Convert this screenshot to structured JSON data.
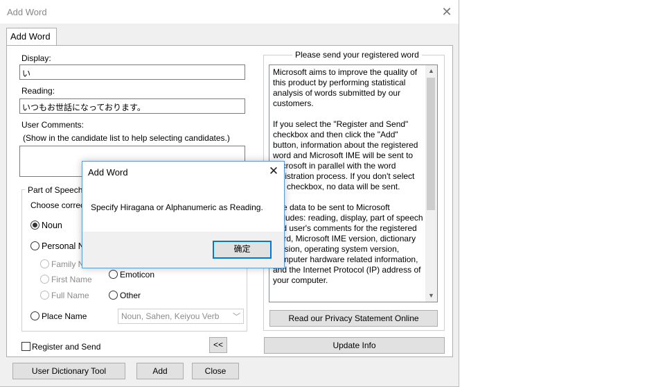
{
  "window": {
    "title": "Add Word"
  },
  "tab": {
    "label": "Add Word"
  },
  "display": {
    "label": "Display:",
    "value": "い"
  },
  "reading": {
    "label": "Reading:",
    "value": "いつもお世話になっております。"
  },
  "comments": {
    "label": "User Comments:",
    "hint": "(Show in the candidate list to help selecting candidates.)"
  },
  "part_of_speech": {
    "legend": "Part of Speech:",
    "instruction": "Choose correc",
    "noun": "Noun",
    "personal_name": "Personal N",
    "family_name": "Family N",
    "first_name": "First Name",
    "full_name": "Full Name",
    "emoticon": "Emoticon",
    "other": "Other",
    "place_name": "Place Name",
    "combo_value": "Noun, Sahen, Keiyou Verb"
  },
  "register_send": {
    "label": "Register and Send"
  },
  "collapse_button": "<<",
  "registered": {
    "legend": "Please send your registered word",
    "text": "Microsoft aims to improve the quality of this product by performing statistical analysis of words submitted by our customers.\n\nIf you select the \"Register and Send\" checkbox and then click the \"Add\" button, information about the registered word and Microsoft IME will be sent to Microsoft in parallel with the word registration process. If you don't select the checkbox, no data will be sent.\n\nThe data to be sent to Microsoft includes: reading, display, part of speech and user's comments for the registered word, Microsoft IME version, dictionary version, operating system version, computer hardware related information, and the Internet Protocol (IP) address of your computer.",
    "privacy_button": "Read our Privacy Statement Online"
  },
  "update_button": "Update Info",
  "footer": {
    "dictionary_tool": "User Dictionary Tool",
    "add": "Add",
    "close": "Close"
  },
  "dialog": {
    "title": "Add Word",
    "message": "Specify Hiragana or Alphanumeric as Reading.",
    "ok": "确定"
  },
  "icons": {
    "close": "close-icon",
    "scroll_up": "scroll-up-icon",
    "scroll_down": "scroll-down-icon",
    "dropdown": "chevron-down-icon"
  },
  "colors": {
    "accent": "#0078d7",
    "dialog_border": "#5a9bd5"
  }
}
